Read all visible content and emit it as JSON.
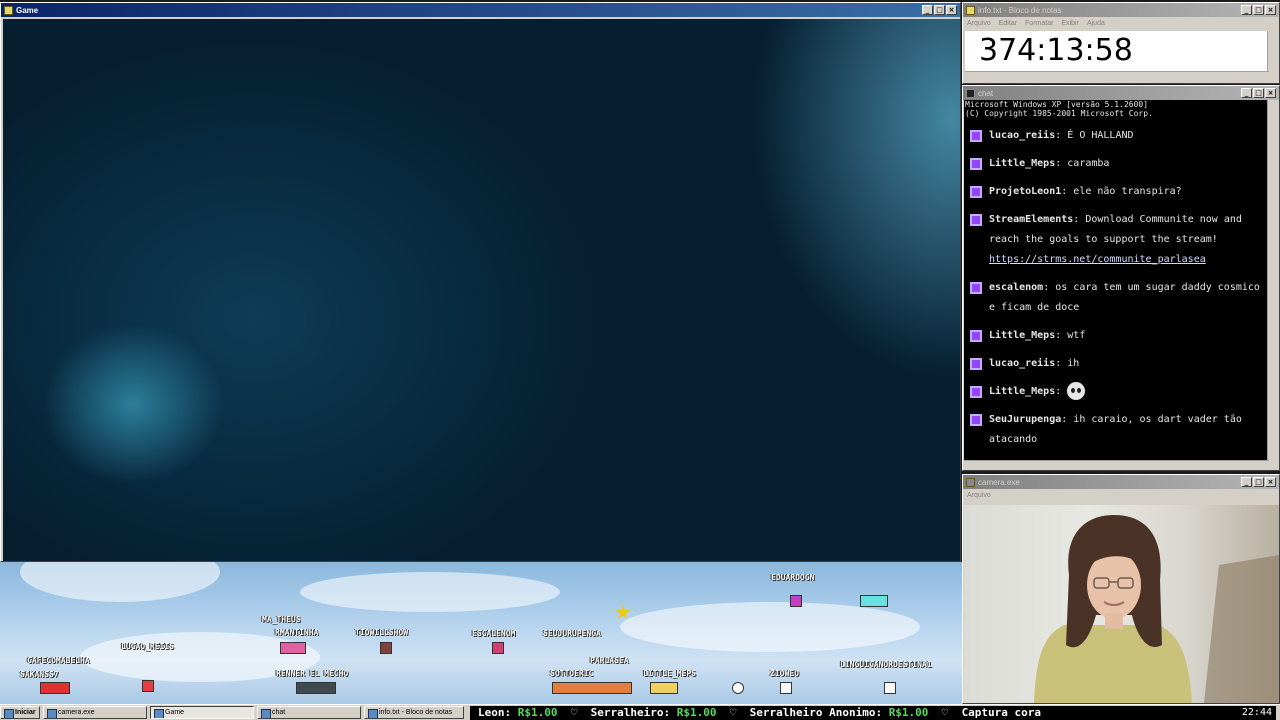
{
  "game_window": {
    "title": "Game"
  },
  "notepad": {
    "title": "info.txt - Bloco de notas",
    "menu": [
      "Arquivo",
      "Editar",
      "Formatar",
      "Exibir",
      "Ajuda"
    ],
    "content": "374:13:58"
  },
  "chat": {
    "title": "chat",
    "sys_lines": [
      "Microsoft Windows XP [versão 5.1.2600]",
      "(C) Copyright 1985-2001 Microsoft Corp."
    ],
    "messages": [
      {
        "user": "lucao_reiis",
        "text": "É O HALLAND"
      },
      {
        "user": "Little_Meps",
        "text": "caramba"
      },
      {
        "user": "ProjetoLeon1",
        "text": "ele não transpira?"
      },
      {
        "user": "StreamElements",
        "text": "Download Communite now and reach the goals to support the stream!",
        "link": "https://strms.net/communite_parlasea"
      },
      {
        "user": "escalenom",
        "text": "os cara tem um sugar daddy cosmico e ficam de doce"
      },
      {
        "user": "Little_Meps",
        "text": "wtf"
      },
      {
        "user": "lucao_reiis",
        "text": "ih"
      },
      {
        "user": "Little_Meps",
        "text": "",
        "emote": "skull-emote"
      },
      {
        "user": "SeuJurupenga",
        "text": "ih caraio, os dart vader tão atacando"
      }
    ]
  },
  "camera": {
    "title": "camera.exe",
    "menu": "Arquivo"
  },
  "scene": {
    "usernames": [
      "EDUARDOGN",
      "MA_THEUS",
      "RMANTINHA",
      "TIOWILLSHOW",
      "ESCALENOM",
      "SEUJURUPENGA",
      "LUCAO_REIIS",
      "CAFECOMABELHA",
      "SAKANSS7",
      "PARLASEA",
      "RENNER EL MECHO",
      "SOTTOERIC",
      "LITTLE_MEPS",
      "ZIOWEO",
      "LINGUICANORDESTINA1"
    ]
  },
  "taskbar": {
    "start": "Iniciar",
    "buttons": [
      "camera.exe",
      "Game",
      "chat",
      "info.txt - Bloco de notas"
    ],
    "ticker": [
      {
        "name": "Leon:",
        "amount": "R$1.00"
      },
      {
        "name": "Serralheiro:",
        "amount": "R$1.00"
      },
      {
        "name": "Serralheiro Anonimo:",
        "amount": "R$1.00"
      }
    ],
    "ticker_tail": "Captura cora",
    "clock": "22:44"
  }
}
